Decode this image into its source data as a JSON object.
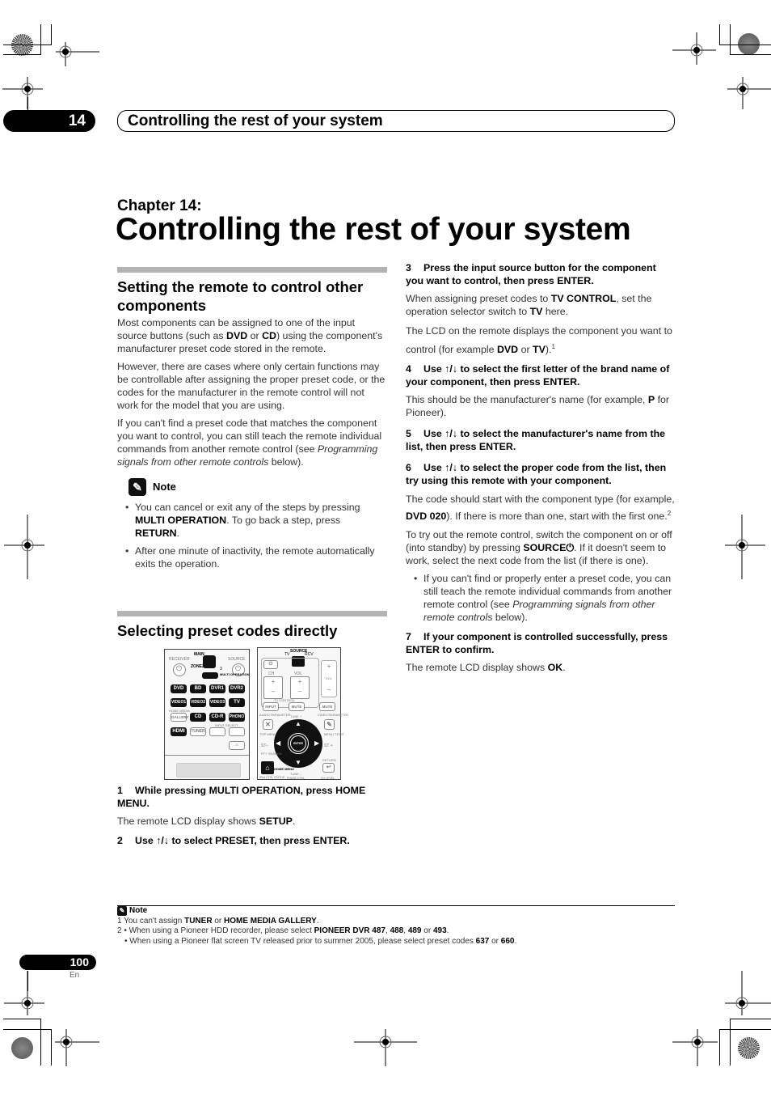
{
  "header": {
    "chapter_number": "14",
    "running_title": "Controlling the rest of your system"
  },
  "chapter": {
    "label": "Chapter 14:",
    "title": "Controlling the rest of your system"
  },
  "left_column": {
    "section1": {
      "title": "Setting the remote to control other components",
      "p1_a": "Most components can be assigned to one of the input source buttons (such as ",
      "p1_b1": "DVD",
      "p1_c": " or ",
      "p1_b2": "CD",
      "p1_d": ") using the component's manufacturer preset code stored in the remote.",
      "p2": "However, there are cases where only certain functions may be controllable after assigning the proper preset code, or the codes for the manufacturer in the remote control will not work for the model that you are using.",
      "p3_a": "If you can't find a preset code that matches the component you want to control, you can still teach the remote individual commands from another remote control (see ",
      "p3_i": "Programming signals from other remote controls",
      "p3_b": " below)."
    },
    "note": {
      "icon": "pencil-icon",
      "heading": "Note",
      "bullet1_a": "You can cancel or exit any of the steps by pressing ",
      "bullet1_b1": "MULTI OPERATION",
      "bullet1_c": ". To go back a step, press ",
      "bullet1_b2": "RETURN",
      "bullet1_d": ".",
      "bullet2": "After one minute of inactivity, the remote automatically exits the operation."
    },
    "section2": {
      "title": "Selecting preset codes directly"
    },
    "remote": {
      "left_panel": {
        "receiver": "RECEIVER",
        "source": "SOURCE",
        "main": "MAIN",
        "zone": "ZONE2",
        "zone3": "3",
        "multi_operation": "MULTI OPERATION",
        "row1": [
          "DVD",
          "BD",
          "DVR1",
          "DVR2"
        ],
        "row2": [
          "VIDEO1",
          "VIDEO2",
          "VIDEO3",
          "TV"
        ],
        "home_media": "HOME MEDIA",
        "row3": [
          "GALLERY",
          "CD",
          "CD-R",
          "PHONO"
        ],
        "row4": [
          "HDMI",
          "TUNER"
        ],
        "input_select": "INPUT SELECT"
      },
      "right_panel": {
        "tv": "TV",
        "source": "SOURCE",
        "rcv": "RCV",
        "ch": "CH",
        "vol": "VOL",
        "tv_control": "TV CONTROL",
        "input": "INPUT",
        "mute": "MUTE",
        "audio_parameter": "AUDIO PARAMETER",
        "exit": "EXIT",
        "tune_plus": "TUNE +",
        "tools": "TOOLS",
        "video_parameter": "VIDEO PARAMETER",
        "top_menu": "TOP MENU BAND",
        "menu": "MENU T.EDIT",
        "st_minus": "ST–",
        "st_plus": "ST +",
        "enter": "ENTER",
        "pty_search": "PTY SEARCH",
        "return": "RETURN",
        "home_menu": "HOME MENU",
        "tune_minus": "TUNE –",
        "ipod": "iPod CTRL STATUS",
        "phase": "PHASE CTRL",
        "ch_level": "CH LEVEL"
      }
    },
    "step1_title": "While pressing MULTI OPERATION, press HOME MENU.",
    "step1_num": "1",
    "step1_body_a": "The remote LCD display shows ",
    "step1_body_b": "SETUP",
    "step1_body_c": ".",
    "step2_num": "2",
    "step2_title": "Use ↑/↓ to select PRESET, then press ENTER."
  },
  "right_column": {
    "step3_num": "3",
    "step3_title": "Press the input source button for the component you want to control, then press ENTER.",
    "step3_p1_a": "When assigning preset codes to ",
    "step3_p1_b1": "TV CONTROL",
    "step3_p1_c": ", set the operation selector switch to ",
    "step3_p1_b2": "TV",
    "step3_p1_d": " here.",
    "step3_p2_a": "The LCD on the remote displays the component you want to control (for example ",
    "step3_p2_b1": "DVD",
    "step3_p2_c": " or ",
    "step3_p2_b2": "TV",
    "step3_p2_d": ").",
    "step3_sup": "1",
    "step4_num": "4",
    "step4_title": "Use ↑/↓ to select the first letter of the brand name of your component, then press ENTER.",
    "step4_p_a": "This should be the manufacturer's name (for example, ",
    "step4_p_b": "P",
    "step4_p_c": " for Pioneer).",
    "step5_num": "5",
    "step5_title": "Use ↑/↓ to select the manufacturer's name from the list, then press ENTER.",
    "step6_num": "6",
    "step6_title": "Use ↑/↓ to select the proper code from the list, then try using this remote with your component.",
    "step6_p1_a": "The code should start with the component type (for example, ",
    "step6_p1_b": "DVD 020",
    "step6_p1_c": "). If there is more than one, start with the first one.",
    "step6_sup": "2",
    "step6_p2_a": "To try out the remote control, switch the component on or off (into standby) by pressing ",
    "step6_p2_b": "SOURCE⏻",
    "step6_p2_c": ". If it doesn't seem to work, select the next code from the list (if there is one).",
    "step6_bullet_a": "If you can't find or properly enter a preset code, you can still teach the remote individual commands from another remote control (see ",
    "step6_bullet_i": "Programming signals from other remote controls",
    "step6_bullet_b": " below).",
    "step7_num": "7",
    "step7_title": "If your component is controlled successfully, press ENTER to confirm.",
    "step7_p_a": "The remote LCD display shows ",
    "step7_p_b": "OK",
    "step7_p_c": "."
  },
  "footnotes": {
    "heading": "Note",
    "icon": "pencil-icon",
    "f1_a": "1 You can't assign ",
    "f1_b1": "TUNER",
    "f1_c": " or ",
    "f1_b2": "HOME MEDIA GALLERY",
    "f1_d": ".",
    "f2_a": "2 • When using a Pioneer HDD recorder, please select ",
    "f2_b1": "PIONEER DVR 487",
    "f2_c": ", ",
    "f2_b2": "488",
    "f2_d": ", ",
    "f2_b3": "489",
    "f2_e": " or ",
    "f2_b4": "493",
    "f2_f": ".",
    "f3_a": "• When using a Pioneer flat screen TV released prior to summer 2005, please select preset codes ",
    "f3_b1": "637",
    "f3_c": " or ",
    "f3_b2": "660",
    "f3_d": "."
  },
  "page": {
    "number": "100",
    "language": "En"
  }
}
